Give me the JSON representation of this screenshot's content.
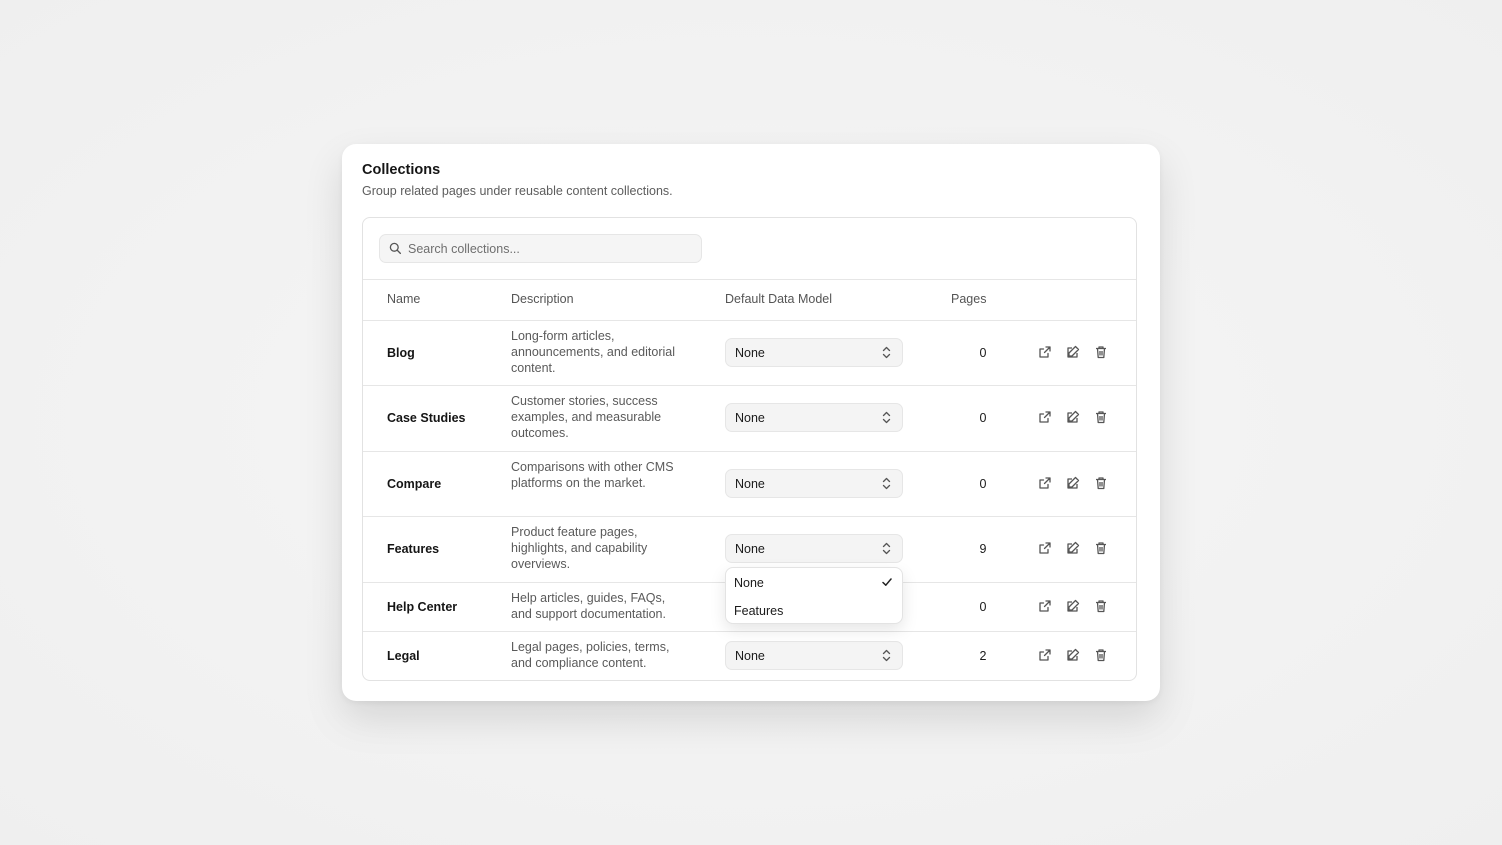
{
  "card": {
    "title": "Collections",
    "subtitle": "Group related pages under reusable content collections."
  },
  "search": {
    "placeholder": "Search collections...",
    "icon": "search-icon"
  },
  "table": {
    "headers": {
      "name": "Name",
      "description": "Description",
      "model": "Default Data Model",
      "pages": "Pages"
    },
    "rows": [
      {
        "name": "Blog",
        "description": "Long-form articles, announcements, and editorial content.",
        "model": "None",
        "pages": "0"
      },
      {
        "name": "Case Studies",
        "description": "Customer stories, success examples, and measurable outcomes.",
        "model": "None",
        "pages": "0"
      },
      {
        "name": "Compare",
        "description": "Comparisons with other CMS platforms on the market.",
        "model": "None",
        "pages": "0"
      },
      {
        "name": "Features",
        "description": "Product feature pages, highlights, and capability overviews.",
        "model": "None",
        "pages": "9"
      },
      {
        "name": "Help Center",
        "description": "Help articles, guides, FAQs, and support documentation.",
        "model": "None",
        "pages": "0"
      },
      {
        "name": "Legal",
        "description": "Legal pages, policies, terms, and compliance content.",
        "model": "None",
        "pages": "2"
      }
    ],
    "row_actions": [
      "external-link-icon",
      "edit-icon",
      "trash-icon"
    ]
  },
  "dropdown": {
    "options": [
      {
        "label": "None",
        "selected": true
      },
      {
        "label": "Features",
        "selected": false
      }
    ],
    "check_icon": "check-icon"
  },
  "colors": {
    "background": "#f2f2f2",
    "card": "#ffffff",
    "border": "#e2e2e2",
    "text_primary": "#151515",
    "text_secondary": "#5a5a5a"
  }
}
